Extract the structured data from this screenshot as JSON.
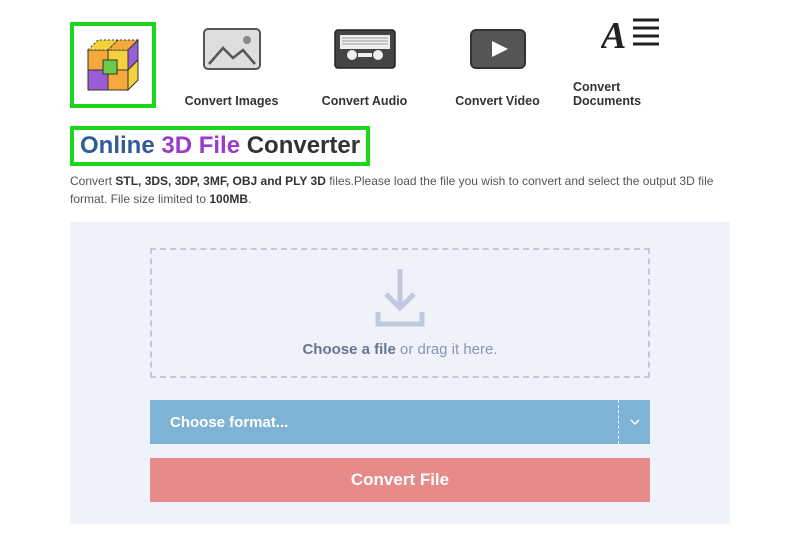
{
  "nav": [
    {
      "label": "Convert Images",
      "icon": "image"
    },
    {
      "label": "Convert Audio",
      "icon": "cassette"
    },
    {
      "label": "Convert Video",
      "icon": "play"
    },
    {
      "label": "Convert Documents",
      "icon": "doc"
    }
  ],
  "title": {
    "a": "Online ",
    "b": "3D File ",
    "c": "Converter"
  },
  "desc": {
    "pre": "Convert ",
    "bold1": "STL, 3DS, 3DP, 3MF, OBJ and PLY 3D",
    "mid": " files.Please load the file you wish to convert and select the output 3D file format. File size limited to ",
    "bold2": "100MB",
    "post": "."
  },
  "dropzone": {
    "bold": "Choose a file",
    "rest": " or drag it here."
  },
  "select": {
    "label": "Choose format..."
  },
  "button": {
    "label": "Convert File"
  },
  "colors": {
    "highlight": "#1bd61b",
    "selectBg": "#7fb3d5",
    "buttonBg": "#e68a8a",
    "panelBg": "#eff2fa"
  }
}
